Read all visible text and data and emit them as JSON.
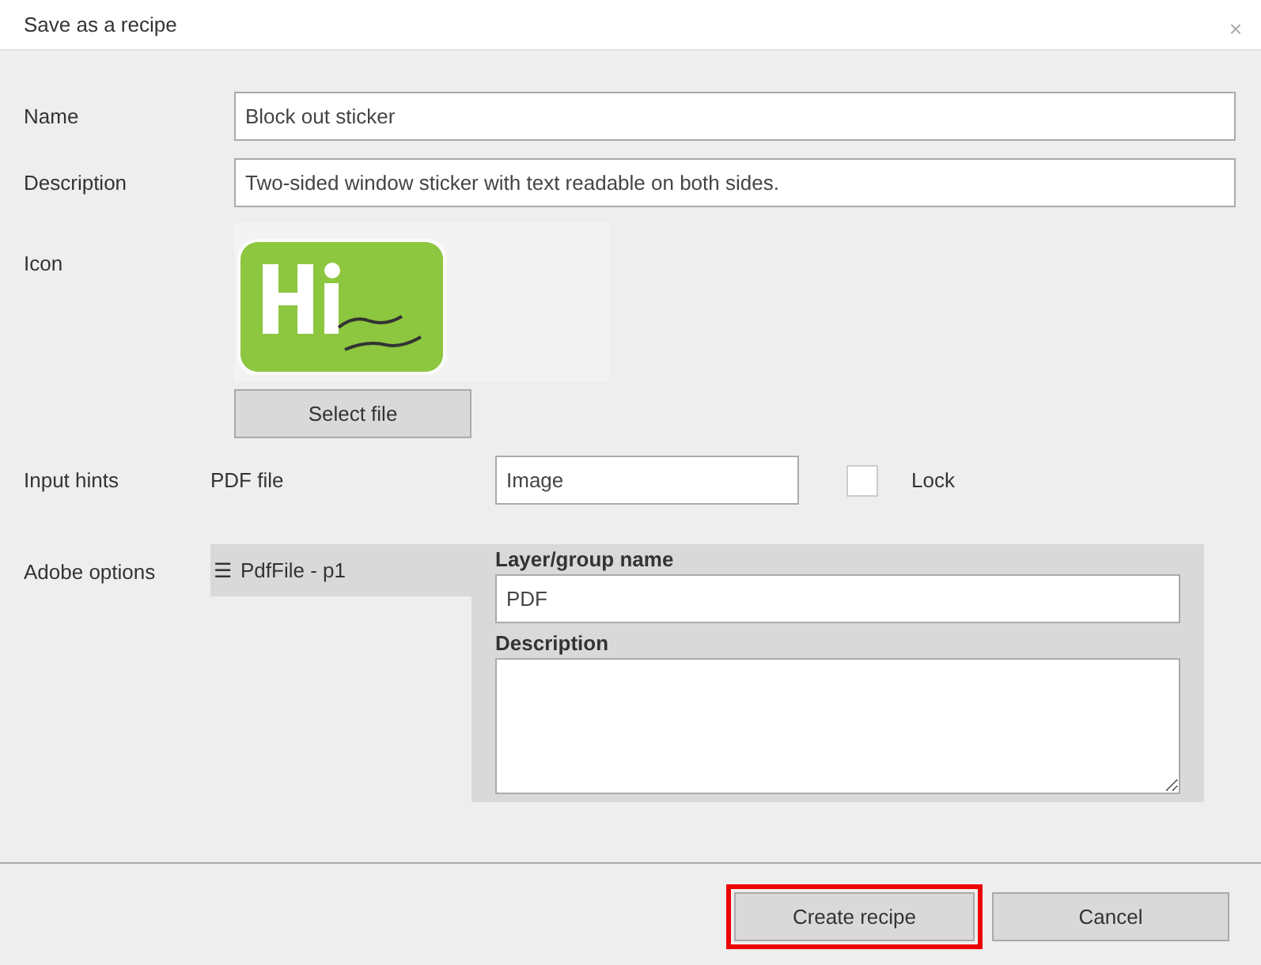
{
  "window": {
    "title": "Save as a recipe",
    "close": "×"
  },
  "name": {
    "label": "Name",
    "value": "Block out sticker"
  },
  "description": {
    "label": "Description",
    "value": "Two-sided window sticker with text readable on both sides."
  },
  "icon": {
    "label": "Icon",
    "button": "Select file"
  },
  "input_hints": {
    "label": "Input hints",
    "file_type": "PDF file",
    "value": "Image",
    "lock": {
      "label": "Lock",
      "checked": false
    }
  },
  "adobe_options": {
    "label": "Adobe options",
    "items": [
      {
        "icon": "☰",
        "label": "PdfFile - p1",
        "selected": true
      }
    ],
    "layer_name": {
      "label": "Layer/group name",
      "value": "PDF"
    },
    "layer_description": {
      "label": "Description"
    }
  },
  "buttons": [
    {
      "label": "Create recipe",
      "highlighted": true
    },
    {
      "label": "Cancel",
      "highlighted": false
    }
  ]
}
